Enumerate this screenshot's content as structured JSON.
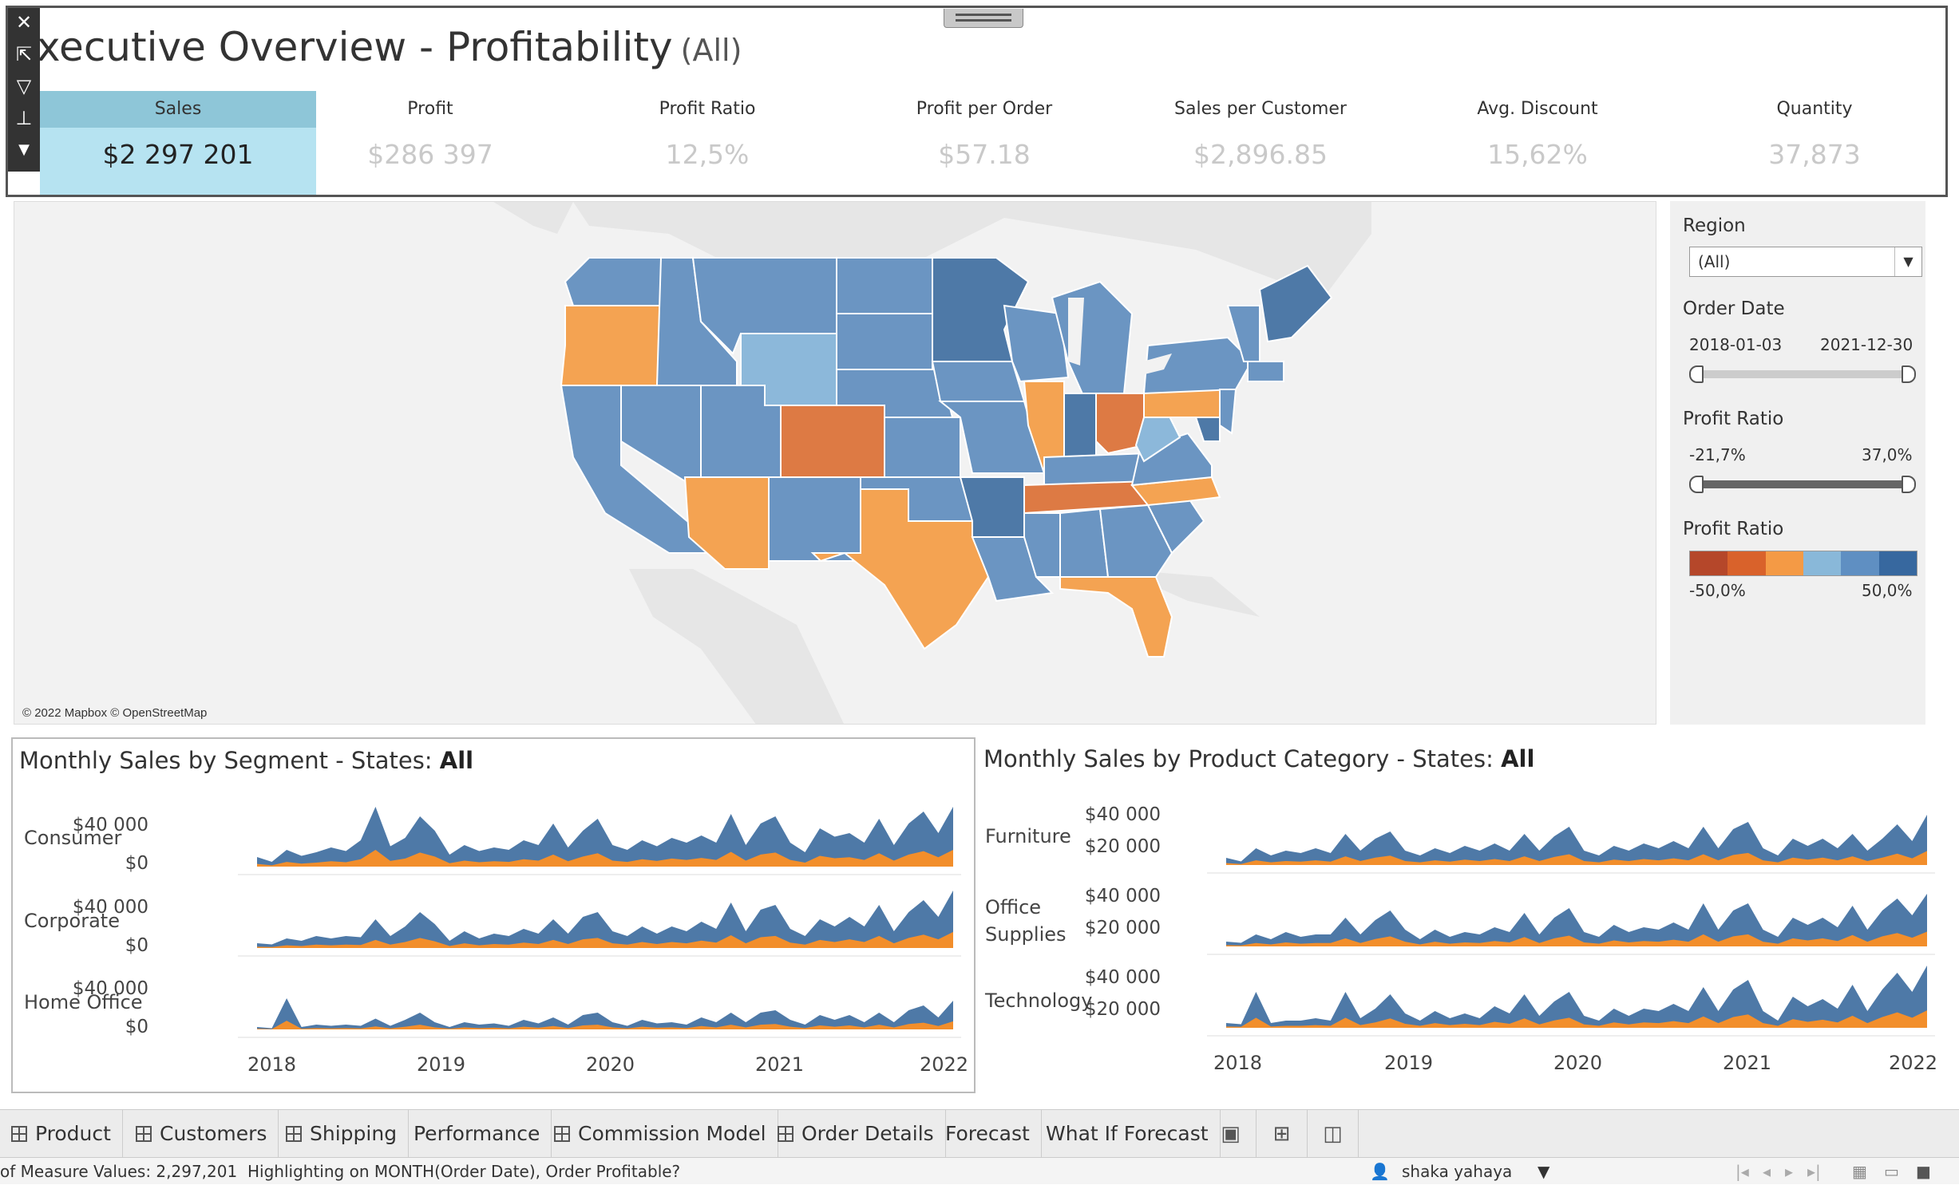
{
  "header": {
    "title": "xecutive Overview - Profitability",
    "title_suffix": "(All)",
    "kpis": [
      {
        "label": "Sales",
        "value": "$2 297 201",
        "selected": true
      },
      {
        "label": "Profit",
        "value": "$286 397"
      },
      {
        "label": "Profit Ratio",
        "value": "12,5%"
      },
      {
        "label": "Profit per Order",
        "value": "$57.18"
      },
      {
        "label": "Sales per Customer",
        "value": "$2,896.85"
      },
      {
        "label": "Avg. Discount",
        "value": "15,62%"
      },
      {
        "label": "Quantity",
        "value": "37,873"
      }
    ],
    "toolbar_icons": [
      "close-icon",
      "open-external-icon",
      "filter-icon",
      "pin-icon",
      "more-icon"
    ]
  },
  "map": {
    "credit": "© 2022 Mapbox © OpenStreetMap",
    "colors": {
      "dark_blue": "#4e79a7",
      "mid_blue": "#6b95c2",
      "light_blue": "#8cb8da",
      "orange": "#f4a352",
      "dark_orange": "#dd7a44",
      "land": "#e6e6e6",
      "water": "#f2f2f2"
    }
  },
  "filters": {
    "region": {
      "label": "Region",
      "value": "(All)"
    },
    "order_date": {
      "label": "Order Date",
      "min": "2018-01-03",
      "max": "2021-12-30"
    },
    "profit_ratio": {
      "label": "Profit Ratio",
      "min": "-21,7%",
      "max": "37,0%"
    },
    "legend": {
      "label": "Profit Ratio",
      "min": "-50,0%",
      "max": "50,0%",
      "colors": [
        "#b5472a",
        "#d9622b",
        "#f49a45",
        "#89b8d9",
        "#5f8fc2",
        "#37689f"
      ]
    }
  },
  "segment_chart": {
    "title": "Monthly Sales by Segment - States:",
    "title_bold": "All",
    "rows": [
      {
        "label": "Consumer",
        "y_top": "$40 000",
        "y_bottom": "$0"
      },
      {
        "label": "Corporate",
        "y_top": "$40 000",
        "y_bottom": "$0"
      },
      {
        "label": "Home Office",
        "y_top": "$40 000",
        "y_bottom": "$0"
      }
    ],
    "x_ticks": [
      "2018",
      "2019",
      "2020",
      "2021",
      "2022"
    ]
  },
  "category_chart": {
    "title": "Monthly Sales by Product Category - States:",
    "title_bold": "All",
    "rows": [
      {
        "label": "Furniture",
        "y_top": "$40 000",
        "y_bottom": "$20 000"
      },
      {
        "label": "Office Supplies",
        "y_top": "$40 000",
        "y_bottom": "$20 000"
      },
      {
        "label": "Technology",
        "y_top": "$40 000",
        "y_bottom": "$20 000"
      }
    ],
    "x_ticks": [
      "2018",
      "2019",
      "2020",
      "2021",
      "2022"
    ]
  },
  "chart_data": [
    {
      "type": "area",
      "title": "Monthly Sales by Segment - States: All",
      "x": [
        "2018-01",
        "2018-02",
        "2018-03",
        "2018-04",
        "2018-05",
        "2018-06",
        "2018-07",
        "2018-08",
        "2018-09",
        "2018-10",
        "2018-11",
        "2018-12",
        "2019-01",
        "2019-02",
        "2019-03",
        "2019-04",
        "2019-05",
        "2019-06",
        "2019-07",
        "2019-08",
        "2019-09",
        "2019-10",
        "2019-11",
        "2019-12",
        "2020-01",
        "2020-02",
        "2020-03",
        "2020-04",
        "2020-05",
        "2020-06",
        "2020-07",
        "2020-08",
        "2020-09",
        "2020-10",
        "2020-11",
        "2020-12",
        "2021-01",
        "2021-02",
        "2021-03",
        "2021-04",
        "2021-05",
        "2021-06",
        "2021-07",
        "2021-08",
        "2021-09",
        "2021-10",
        "2021-11",
        "2021-12"
      ],
      "series": [
        {
          "name": "Consumer",
          "values": [
            8000,
            4000,
            14000,
            9000,
            12000,
            16000,
            13000,
            22000,
            50000,
            17000,
            24000,
            42000,
            30000,
            10000,
            18000,
            13000,
            16000,
            14000,
            22000,
            18000,
            36000,
            16000,
            30000,
            40000,
            18000,
            14000,
            22000,
            17000,
            24000,
            20000,
            26000,
            20000,
            44000,
            18000,
            36000,
            42000,
            20000,
            12000,
            32000,
            25000,
            28000,
            20000,
            40000,
            18000,
            36000,
            46000,
            28000,
            50000
          ]
        },
        {
          "name": "Corporate",
          "values": [
            4000,
            3000,
            8000,
            6000,
            10000,
            8000,
            10000,
            9000,
            24000,
            10000,
            18000,
            30000,
            20000,
            6000,
            14000,
            8000,
            12000,
            10000,
            16000,
            12000,
            24000,
            12000,
            26000,
            30000,
            14000,
            10000,
            18000,
            12000,
            18000,
            14000,
            22000,
            16000,
            38000,
            14000,
            32000,
            36000,
            16000,
            10000,
            24000,
            18000,
            26000,
            18000,
            36000,
            14000,
            30000,
            40000,
            26000,
            48000
          ]
        },
        {
          "name": "Home Office",
          "values": [
            2000,
            1000,
            26000,
            2000,
            4000,
            3000,
            4000,
            3000,
            9000,
            3000,
            8000,
            14000,
            6000,
            2000,
            6000,
            4000,
            5000,
            3000,
            8000,
            5000,
            10000,
            4000,
            12000,
            14000,
            6000,
            3000,
            8000,
            5000,
            6000,
            4000,
            10000,
            6000,
            14000,
            6000,
            14000,
            16000,
            8000,
            4000,
            12000,
            8000,
            12000,
            6000,
            14000,
            6000,
            16000,
            20000,
            10000,
            24000
          ]
        }
      ],
      "xlabel": "",
      "ylabel": "",
      "x_ticks": [
        "2018",
        "2019",
        "2020",
        "2021",
        "2022"
      ]
    },
    {
      "type": "area",
      "title": "Monthly Sales by Product Category - States: All",
      "x": [
        "2018-01",
        "2018-02",
        "2018-03",
        "2018-04",
        "2018-05",
        "2018-06",
        "2018-07",
        "2018-08",
        "2018-09",
        "2018-10",
        "2018-11",
        "2018-12",
        "2019-01",
        "2019-02",
        "2019-03",
        "2019-04",
        "2019-05",
        "2019-06",
        "2019-07",
        "2019-08",
        "2019-09",
        "2019-10",
        "2019-11",
        "2019-12",
        "2020-01",
        "2020-02",
        "2020-03",
        "2020-04",
        "2020-05",
        "2020-06",
        "2020-07",
        "2020-08",
        "2020-09",
        "2020-10",
        "2020-11",
        "2020-12",
        "2021-01",
        "2021-02",
        "2021-03",
        "2021-04",
        "2021-05",
        "2021-06",
        "2021-07",
        "2021-08",
        "2021-09",
        "2021-10",
        "2021-11",
        "2021-12"
      ],
      "series": [
        {
          "name": "Furniture",
          "values": [
            6000,
            3000,
            14000,
            8000,
            12000,
            10000,
            14000,
            10000,
            26000,
            12000,
            22000,
            28000,
            12000,
            8000,
            14000,
            10000,
            16000,
            12000,
            18000,
            12000,
            26000,
            12000,
            24000,
            32000,
            12000,
            8000,
            16000,
            12000,
            18000,
            14000,
            20000,
            14000,
            32000,
            14000,
            30000,
            36000,
            14000,
            8000,
            22000,
            16000,
            22000,
            14000,
            26000,
            12000,
            22000,
            34000,
            20000,
            42000
          ]
        },
        {
          "name": "Office Supplies",
          "values": [
            4000,
            3000,
            10000,
            6000,
            12000,
            8000,
            10000,
            10000,
            24000,
            10000,
            22000,
            30000,
            14000,
            6000,
            14000,
            8000,
            12000,
            10000,
            16000,
            12000,
            28000,
            10000,
            24000,
            32000,
            12000,
            8000,
            18000,
            12000,
            16000,
            14000,
            20000,
            14000,
            36000,
            14000,
            30000,
            36000,
            14000,
            8000,
            24000,
            18000,
            24000,
            16000,
            34000,
            14000,
            30000,
            40000,
            26000,
            44000
          ]
        },
        {
          "name": "Technology",
          "values": [
            4000,
            3000,
            30000,
            4000,
            6000,
            6000,
            8000,
            6000,
            30000,
            8000,
            16000,
            28000,
            12000,
            6000,
            14000,
            8000,
            12000,
            8000,
            18000,
            12000,
            28000,
            10000,
            22000,
            30000,
            10000,
            6000,
            16000,
            10000,
            16000,
            14000,
            20000,
            14000,
            34000,
            14000,
            32000,
            40000,
            14000,
            6000,
            26000,
            18000,
            24000,
            16000,
            36000,
            14000,
            32000,
            46000,
            30000,
            52000
          ]
        }
      ],
      "xlabel": "",
      "ylabel": "",
      "x_ticks": [
        "2018",
        "2019",
        "2020",
        "2021",
        "2022"
      ]
    }
  ],
  "tabs": [
    {
      "label": "Product",
      "icon": "grid-icon"
    },
    {
      "label": "Customers",
      "icon": "grid-icon"
    },
    {
      "label": "Shipping",
      "icon": "grid-icon"
    },
    {
      "label": "Performance",
      "icon": ""
    },
    {
      "label": "Commission Model",
      "icon": "grid-icon"
    },
    {
      "label": "Order Details",
      "icon": "grid-icon"
    },
    {
      "label": "Forecast",
      "icon": ""
    },
    {
      "label": "What If Forecast",
      "icon": ""
    }
  ],
  "status": {
    "left": "of Measure Values: 2,297,201",
    "middle": "Highlighting on MONTH(Order Date), Order Profitable?",
    "user": "shaka yahaya"
  },
  "series_colors": {
    "blue": "#4e79a7",
    "orange": "#f28e2b"
  }
}
